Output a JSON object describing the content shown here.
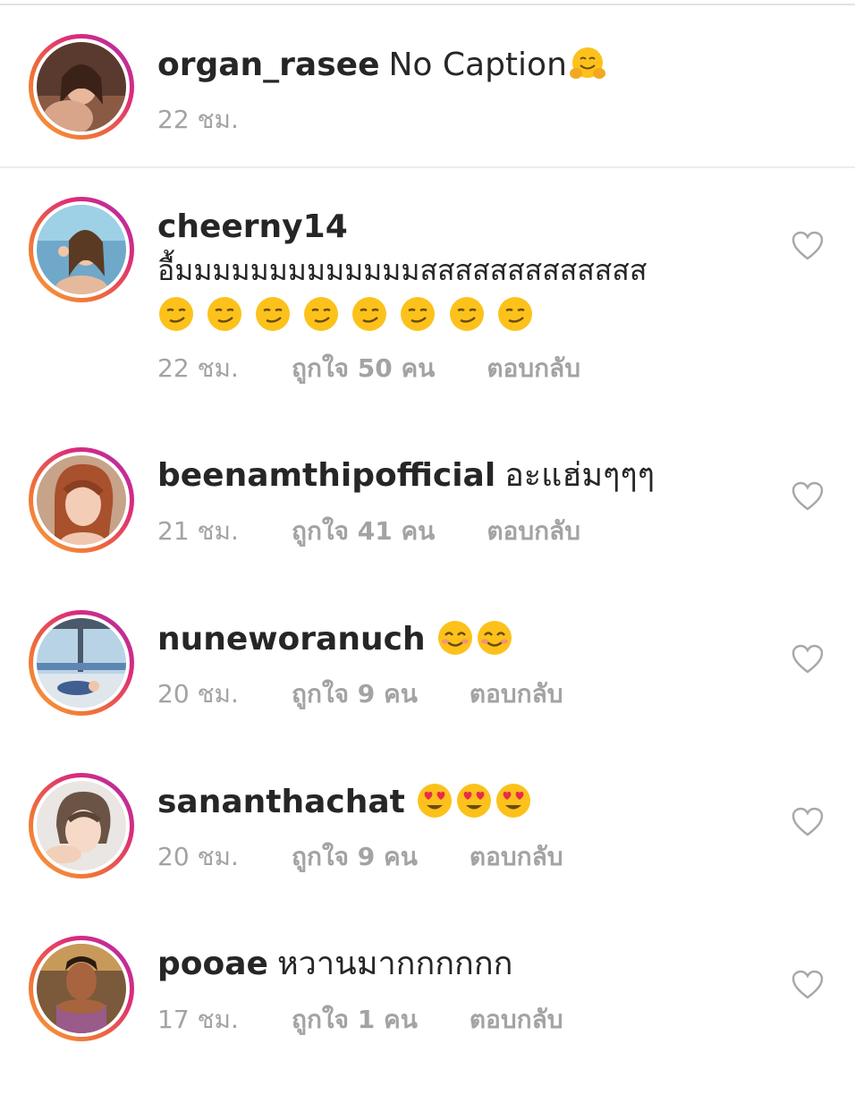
{
  "caption": {
    "username": "organ_rasee",
    "text": "No Caption",
    "emoji": "hugging-face",
    "time": "22 ชม."
  },
  "comments": [
    {
      "username": "cheerny14",
      "text": "อื้มมมมมมมมมมมมมสสสสสสสสสสสสส",
      "emojis": [
        "smirk-face",
        "smirk-face",
        "smirk-face",
        "smirk-face",
        "smirk-face",
        "smirk-face",
        "smirk-face",
        "smirk-face"
      ],
      "time": "22 ชม.",
      "likes": "ถูกใจ 50 คน",
      "reply": "ตอบกลับ"
    },
    {
      "username": "beenamthipofficial",
      "text": "อะแฮ่มๆๆๆ",
      "time": "21 ชม.",
      "likes": "ถูกใจ 41 คน",
      "reply": "ตอบกลับ"
    },
    {
      "username": "nuneworanuch",
      "text": "",
      "emojis": [
        "smiling-face",
        "smiling-face"
      ],
      "time": "20 ชม.",
      "likes": "ถูกใจ 9 คน",
      "reply": "ตอบกลับ"
    },
    {
      "username": "sananthachat",
      "text": "",
      "emojis": [
        "heart-eyes-face",
        "heart-eyes-face",
        "heart-eyes-face"
      ],
      "time": "20 ชม.",
      "likes": "ถูกใจ 9 คน",
      "reply": "ตอบกลับ"
    },
    {
      "username": "pooae",
      "text": "หวานมากกกกกก",
      "time": "17 ชม.",
      "likes": "ถูกใจ 1 คน",
      "reply": "ตอบกลับ"
    }
  ],
  "colors": {
    "text": "#262626",
    "meta": "#a3a3a3",
    "divider": "#ececec",
    "ring_start": "#f9a13a",
    "ring_end": "#a431b5"
  }
}
